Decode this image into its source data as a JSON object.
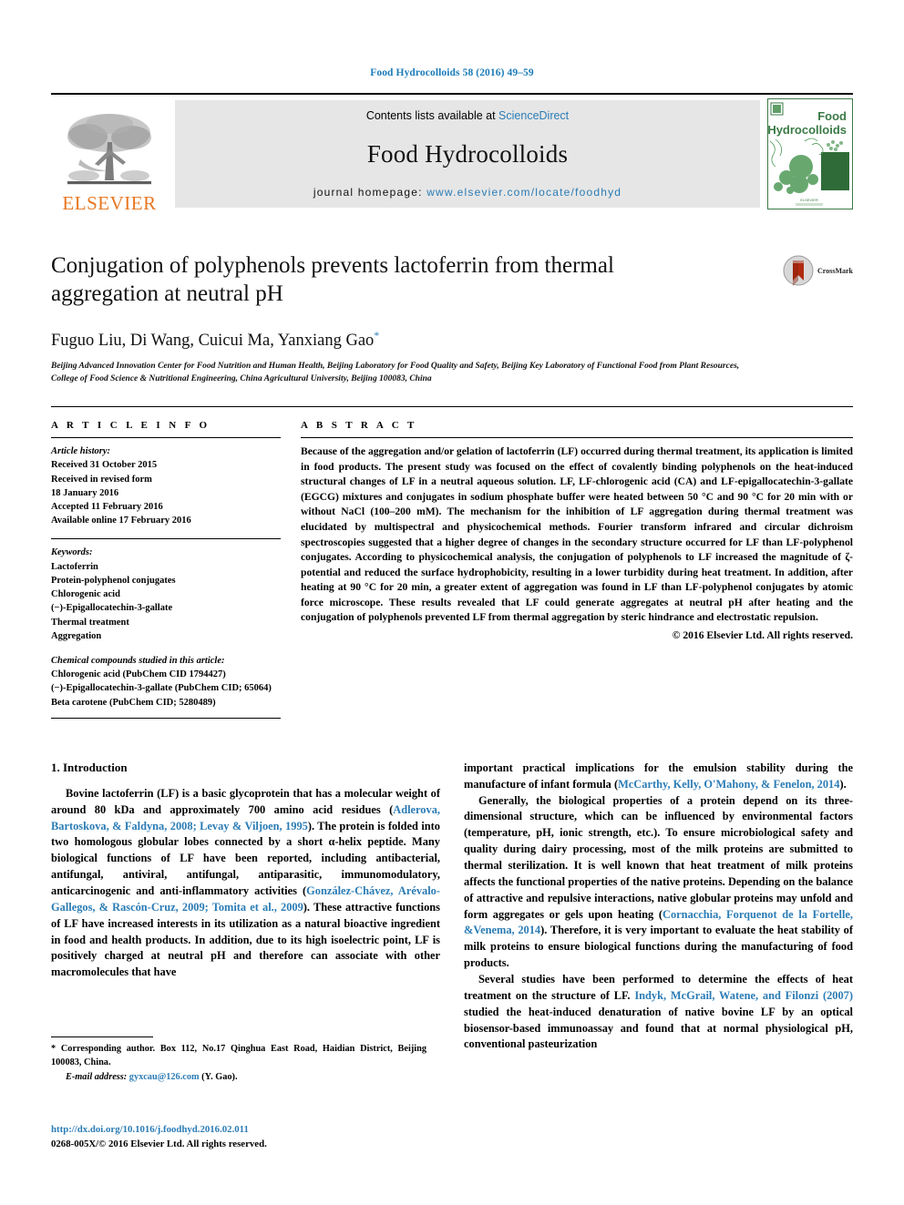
{
  "running_head": "Food Hydrocolloids 58 (2016) 49–59",
  "masthead": {
    "publisher_name": "ELSEVIER",
    "contents_prefix": "Contents lists available at ",
    "contents_link": "ScienceDirect",
    "journal_title": "Food Hydrocolloids",
    "homepage_prefix": "journal homepage: ",
    "homepage_url": "www.elsevier.com/locate/foodhyd",
    "cover_line1": "Food",
    "cover_line2": "Hydrocolloids",
    "colors": {
      "link": "#2b7cb5",
      "elsevier_orange": "#E87722",
      "band_grey": "#e6e6e6",
      "cover_green": "#3b7a46"
    }
  },
  "title_block": {
    "title": "Conjugation of polyphenols prevents lactoferrin from thermal aggregation at neutral pH",
    "authors": "Fuguo Liu, Di Wang, Cuicui Ma, Yanxiang Gao",
    "corresponding_marker": "*",
    "affiliation": "Beijing Advanced Innovation Center for Food Nutrition and Human Health, Beijing Laboratory for Food Quality and Safety, Beijing Key Laboratory of Functional Food from Plant Resources, College of Food Science & Nutritional Engineering, China Agricultural University, Beijing 100083, China",
    "crossmark_label": "CrossMark"
  },
  "article_info": {
    "heading": "A R T I C L E   I N F O",
    "history_label": "Article history:",
    "history": [
      "Received 31 October 2015",
      "Received in revised form",
      "18 January 2016",
      "Accepted 11 February 2016",
      "Available online 17 February 2016"
    ],
    "keywords_label": "Keywords:",
    "keywords": [
      "Lactoferrin",
      "Protein-polyphenol conjugates",
      "Chlorogenic acid",
      "(−)-Epigallocatechin-3-gallate",
      "Thermal treatment",
      "Aggregation"
    ],
    "compounds_label": "Chemical compounds studied in this article:",
    "compounds": [
      "Chlorogenic acid (PubChem CID 1794427)",
      "(−)-Epigallocatechin-3-gallate (PubChem CID; 65064)",
      "Beta carotene (PubChem CID; 5280489)"
    ]
  },
  "abstract": {
    "heading": "A B S T R A C T",
    "text": "Because of the aggregation and/or gelation of lactoferrin (LF) occurred during thermal treatment, its application is limited in food products. The present study was focused on the effect of covalently binding polyphenols on the heat-induced structural changes of LF in a neutral aqueous solution. LF, LF-chlorogenic acid (CA) and LF-epigallocatechin-3-gallate (EGCG) mixtures and conjugates in sodium phosphate buffer were heated between 50 °C and 90 °C for 20 min with or without NaCl (100–200 mM). The mechanism for the inhibition of LF aggregation during thermal treatment was elucidated by multispectral and physicochemical methods. Fourier transform infrared and circular dichroism spectroscopies suggested that a higher degree of changes in the secondary structure occurred for LF than LF-polyphenol conjugates. According to physicochemical analysis, the conjugation of polyphenols to LF increased the magnitude of ζ-potential and reduced the surface hydrophobicity, resulting in a lower turbidity during heat treatment. In addition, after heating at 90 °C for 20 min, a greater extent of aggregation was found in LF than LF-polyphenol conjugates by atomic force microscope. These results revealed that LF could generate aggregates at neutral pH after heating and the conjugation of polyphenols prevented LF from thermal aggregation by steric hindrance and electrostatic repulsion.",
    "copyright": "© 2016 Elsevier Ltd. All rights reserved."
  },
  "body": {
    "section_heading": "1.  Introduction",
    "left_paragraphs": [
      {
        "segments": [
          {
            "t": "Bovine lactoferrin (LF) is a basic glycoprotein that has a molecular weight of around 80 kDa and approximately 700 amino acid residues (",
            "link": false
          },
          {
            "t": "Adlerova, Bartoskova, & Faldyna, 2008; Levay & Viljoen, 1995",
            "link": true
          },
          {
            "t": "). The protein is folded into two homologous globular lobes connected by a short α-helix peptide. Many biological functions of LF have been reported, including antibacterial, antifungal, antiviral, antifungal, antiparasitic, immunomodulatory, anticarcinogenic and anti-inflammatory activities (",
            "link": false
          },
          {
            "t": "González-Chávez, Arévalo-Gallegos, & Rascón-Cruz, 2009; Tomita et al., 2009",
            "link": true
          },
          {
            "t": "). These attractive functions of LF have increased interests in its utilization as a natural bioactive ingredient in food and health products. In addition, due to its high isoelectric point, LF is positively charged at neutral pH and therefore can associate with other macromolecules that have",
            "link": false
          }
        ]
      }
    ],
    "right_paragraphs": [
      {
        "indent": false,
        "segments": [
          {
            "t": "important practical implications for the emulsion stability during the manufacture of infant formula (",
            "link": false
          },
          {
            "t": "McCarthy, Kelly, O'Mahony, & Fenelon, 2014",
            "link": true
          },
          {
            "t": ").",
            "link": false
          }
        ]
      },
      {
        "indent": true,
        "segments": [
          {
            "t": "Generally, the biological properties of a protein depend on its three-dimensional structure, which can be influenced by environmental factors (temperature, pH, ionic strength, etc.). To ensure microbiological safety and quality during dairy processing, most of the milk proteins are submitted to thermal sterilization. It is well known that heat treatment of milk proteins affects the functional properties of the native proteins. Depending on the balance of attractive and repulsive interactions, native globular proteins may unfold and form aggregates or gels upon heating (",
            "link": false
          },
          {
            "t": "Cornacchia, Forquenot de la Fortelle, &Venema, 2014",
            "link": true
          },
          {
            "t": "). Therefore, it is very important to evaluate the heat stability of milk proteins to ensure biological functions during the manufacturing of food products.",
            "link": false
          }
        ]
      },
      {
        "indent": true,
        "segments": [
          {
            "t": "Several studies have been performed to determine the effects of heat treatment on the structure of LF. ",
            "link": false
          },
          {
            "t": "Indyk, McGrail, Watene, and Filonzi (2007)",
            "link": true
          },
          {
            "t": " studied the heat-induced denaturation of native bovine LF by an optical biosensor-based immunoassay and found that at normal physiological pH, conventional pasteurization",
            "link": false
          }
        ]
      }
    ]
  },
  "footnote": {
    "marker": "*",
    "text": "Corresponding author. Box 112, No.17 Qinghua East Road, Haidian District, Beijing 100083, China.",
    "email_label": "E-mail address:",
    "email": "gyxcau@126.com",
    "email_suffix": "(Y. Gao)."
  },
  "doi_block": {
    "doi_url": "http://dx.doi.org/10.1016/j.foodhyd.2016.02.011",
    "issn_line": "0268-005X/© 2016 Elsevier Ltd. All rights reserved."
  }
}
